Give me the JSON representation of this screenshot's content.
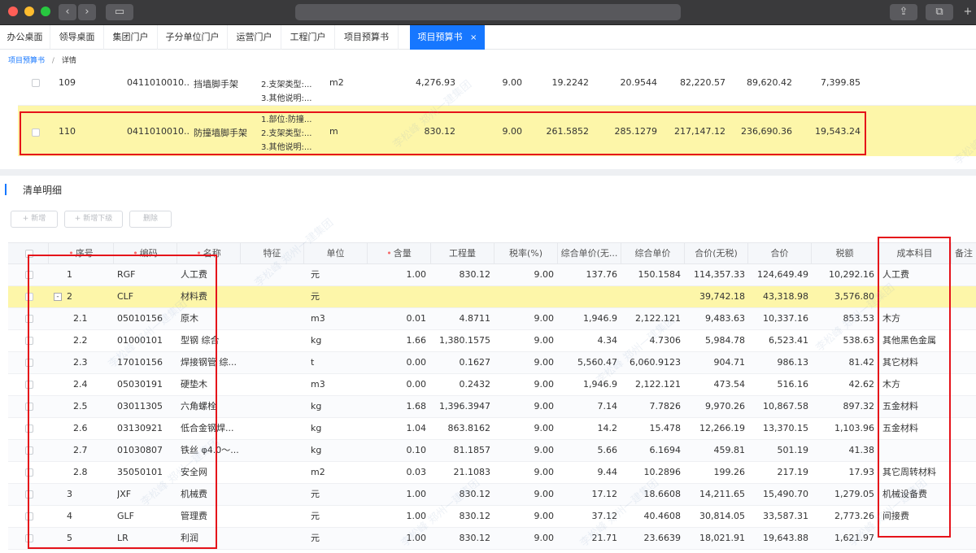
{
  "colors": {
    "accent": "#1677ff",
    "highlight": "#fdf6a9",
    "annotation": "#e5121a",
    "titlebar": "#3a3a3c"
  },
  "tabs": [
    {
      "label": "办公桌面"
    },
    {
      "label": "领导桌面"
    },
    {
      "label": "集团门户"
    },
    {
      "label": "子分单位门户"
    },
    {
      "label": "运营门户"
    },
    {
      "label": "工程门户"
    },
    {
      "label": "项目预算书"
    },
    {
      "label": "项目预算书",
      "active": true
    }
  ],
  "tab_close_icon": "×",
  "breadcrumb": {
    "link": "项目预算书",
    "separator": "/",
    "current": "详情"
  },
  "upper_rows": [
    {
      "no": "109",
      "code": "0411010010...",
      "name": "挡墙脚手架",
      "feature_lines": [
        "2.支架类型:...",
        "3.其他说明:..."
      ],
      "unit": "m2",
      "qty": "4,276.93",
      "tax": "9.00",
      "price_ex": "19.2242",
      "price": "20.9544",
      "total_ex": "82,220.57",
      "total": "89,620.42",
      "tax_amt": "7,399.85"
    },
    {
      "no": "110",
      "code": "0411010010...",
      "name": "防撞墙脚手架",
      "feature_lines": [
        "1.部位:防撞...",
        "2.支架类型:...",
        "3.其他说明:..."
      ],
      "unit": "m",
      "qty": "830.12",
      "tax": "9.00",
      "price_ex": "261.5852",
      "price": "285.1279",
      "total_ex": "217,147.12",
      "total": "236,690.36",
      "tax_amt": "19,543.24"
    }
  ],
  "section_title": "清单明细",
  "buttons": {
    "add": "+ 新增",
    "add_child": "+ 新增下级",
    "delete": "删除"
  },
  "columns": [
    "序号",
    "编码",
    "名称",
    "特征",
    "单位",
    "含量",
    "工程量",
    "税率(%)",
    "综合单价(无...",
    "综合单价",
    "合价(无税)",
    "合价",
    "税额",
    "成本科目",
    "备注"
  ],
  "rows": [
    {
      "no": "1",
      "code": "RGF",
      "name": "人工费",
      "unit": "元",
      "content": "1.00",
      "qty": "830.12",
      "tax": "9.00",
      "price_ex": "137.76",
      "price": "150.1584",
      "total_ex": "114,357.33",
      "total": "124,649.49",
      "tax_amt": "10,292.16",
      "subject": "人工费"
    },
    {
      "no": "2",
      "code": "CLF",
      "name": "材料费",
      "unit": "元",
      "content": "",
      "qty": "",
      "tax": "",
      "price_ex": "",
      "price": "",
      "total_ex": "39,742.18",
      "total": "43,318.98",
      "tax_amt": "3,576.80",
      "subject": "",
      "expand": "-"
    },
    {
      "no": "2.1",
      "code": "05010156",
      "name": "原木",
      "unit": "m3",
      "content": "0.01",
      "qty": "4.8711",
      "tax": "9.00",
      "price_ex": "1,946.9",
      "price": "2,122.121",
      "total_ex": "9,483.63",
      "total": "10,337.16",
      "tax_amt": "853.53",
      "subject": "木方"
    },
    {
      "no": "2.2",
      "code": "01000101",
      "name": "型钢 综合",
      "unit": "kg",
      "content": "1.66",
      "qty": "1,380.1575",
      "tax": "9.00",
      "price_ex": "4.34",
      "price": "4.7306",
      "total_ex": "5,984.78",
      "total": "6,523.41",
      "tax_amt": "538.63",
      "subject": "其他黑色金属"
    },
    {
      "no": "2.3",
      "code": "17010156",
      "name": "焊接钢管 综...",
      "unit": "t",
      "content": "0.00",
      "qty": "0.1627",
      "tax": "9.00",
      "price_ex": "5,560.47",
      "price": "6,060.9123",
      "total_ex": "904.71",
      "total": "986.13",
      "tax_amt": "81.42",
      "subject": "其它材料"
    },
    {
      "no": "2.4",
      "code": "05030191",
      "name": "硬垫木",
      "unit": "m3",
      "content": "0.00",
      "qty": "0.2432",
      "tax": "9.00",
      "price_ex": "1,946.9",
      "price": "2,122.121",
      "total_ex": "473.54",
      "total": "516.16",
      "tax_amt": "42.62",
      "subject": "木方"
    },
    {
      "no": "2.5",
      "code": "03011305",
      "name": "六角螺栓",
      "unit": "kg",
      "content": "1.68",
      "qty": "1,396.3947",
      "tax": "9.00",
      "price_ex": "7.14",
      "price": "7.7826",
      "total_ex": "9,970.26",
      "total": "10,867.58",
      "tax_amt": "897.32",
      "subject": "五金材料"
    },
    {
      "no": "2.6",
      "code": "03130921",
      "name": "低合金钢焊...",
      "unit": "kg",
      "content": "1.04",
      "qty": "863.8162",
      "tax": "9.00",
      "price_ex": "14.2",
      "price": "15.478",
      "total_ex": "12,266.19",
      "total": "13,370.15",
      "tax_amt": "1,103.96",
      "subject": "五金材料"
    },
    {
      "no": "2.7",
      "code": "01030807",
      "name": "铁丝 φ4.0～...",
      "unit": "kg",
      "content": "0.10",
      "qty": "81.1857",
      "tax": "9.00",
      "price_ex": "5.66",
      "price": "6.1694",
      "total_ex": "459.81",
      "total": "501.19",
      "tax_amt": "41.38",
      "subject": ""
    },
    {
      "no": "2.8",
      "code": "35050101",
      "name": "安全网",
      "unit": "m2",
      "content": "0.03",
      "qty": "21.1083",
      "tax": "9.00",
      "price_ex": "9.44",
      "price": "10.2896",
      "total_ex": "199.26",
      "total": "217.19",
      "tax_amt": "17.93",
      "subject": "其它周转材料"
    },
    {
      "no": "3",
      "code": "JXF",
      "name": "机械费",
      "unit": "元",
      "content": "1.00",
      "qty": "830.12",
      "tax": "9.00",
      "price_ex": "17.12",
      "price": "18.6608",
      "total_ex": "14,211.65",
      "total": "15,490.70",
      "tax_amt": "1,279.05",
      "subject": "机械设备费"
    },
    {
      "no": "4",
      "code": "GLF",
      "name": "管理费",
      "unit": "元",
      "content": "1.00",
      "qty": "830.12",
      "tax": "9.00",
      "price_ex": "37.12",
      "price": "40.4608",
      "total_ex": "30,814.05",
      "total": "33,587.31",
      "tax_amt": "2,773.26",
      "subject": "间接费"
    },
    {
      "no": "5",
      "code": "LR",
      "name": "利润",
      "unit": "元",
      "content": "1.00",
      "qty": "830.12",
      "tax": "9.00",
      "price_ex": "21.71",
      "price": "23.6639",
      "total_ex": "18,021.91",
      "total": "19,643.88",
      "tax_amt": "1,621.97",
      "subject": ""
    }
  ],
  "watermark": "李松峰 郑州一建集团"
}
